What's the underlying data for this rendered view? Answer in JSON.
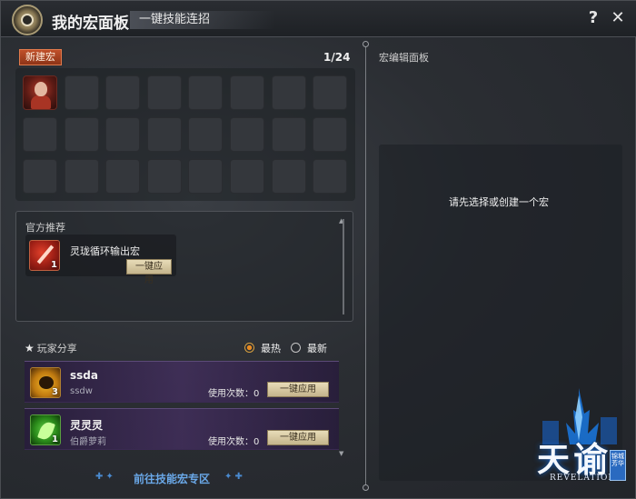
{
  "window": {
    "title": "我的宏面板",
    "subtitle": "一键技能连招",
    "help_label": "?",
    "close_label": "✕"
  },
  "macro_list": {
    "new_button": "新建宏",
    "count": "1/24",
    "slots_total": 24,
    "filled_slots": 1
  },
  "official": {
    "heading": "官方推荐",
    "items": [
      {
        "name": "灵珑循环输出宏",
        "badge": "1",
        "apply_label": "一键应用",
        "icon": "sword-icon"
      }
    ]
  },
  "player_share": {
    "heading": "玩家分享",
    "sort_options": [
      {
        "label": "最热",
        "selected": true
      },
      {
        "label": "最新",
        "selected": false
      }
    ],
    "items": [
      {
        "name": "ssda",
        "author": "ssdw",
        "badge": "3",
        "use_label": "使用次数：",
        "use_count": "0",
        "apply_label": "一键应用",
        "icon": "pumpkin-icon"
      },
      {
        "name": "灵灵灵",
        "author": "伯爵萝莉",
        "badge": "1",
        "use_label": "使用次数：",
        "use_count": "0",
        "apply_label": "一键应用",
        "icon": "leaf-icon"
      }
    ]
  },
  "footer_link": "前往技能宏专区",
  "editor": {
    "heading": "宏编辑面板",
    "empty_message": "请先选择或创建一个宏"
  },
  "logo": {
    "main_left": "天",
    "main_right": "谕",
    "subtitle": "REVELATION",
    "badge": "锦城芳华"
  },
  "colors": {
    "accent_orange": "#c0502a",
    "link_blue": "#6aa8e8",
    "apply_button": "#e8dcb8"
  }
}
